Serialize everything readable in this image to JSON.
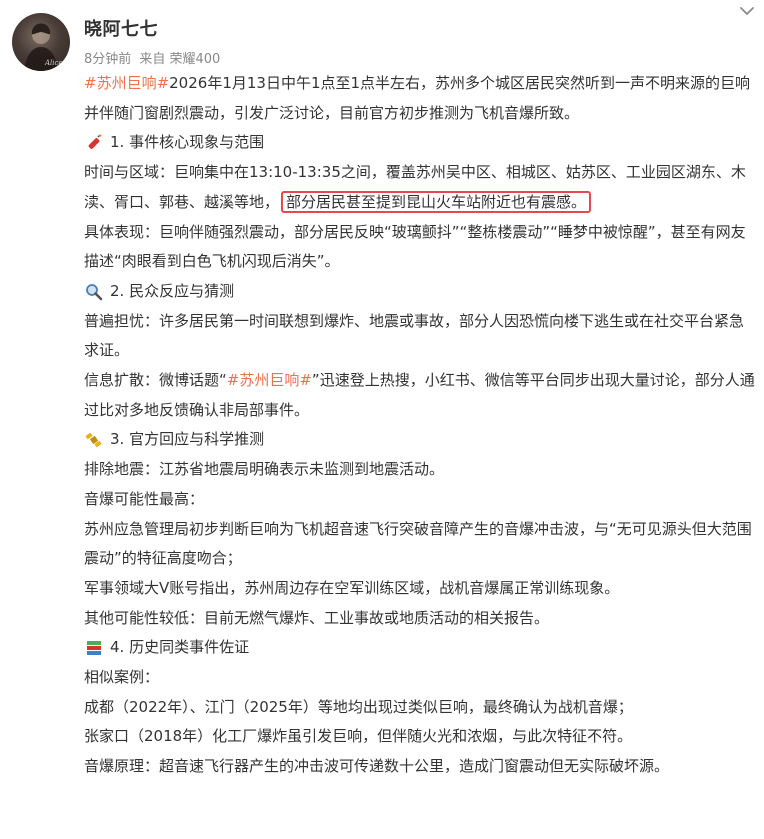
{
  "post": {
    "username": "晓阿七七",
    "time": "8分钟前",
    "source_prefix": "来自",
    "device": "荣耀400",
    "hashtag": "#苏州巨响#",
    "intro": "2026年1月13日中午1点至1点半左右，苏州多个城区居民突然听到一声不明来源的巨响并伴随门窗剧烈震动，引发广泛讨论，目前官方初步推测为飞机音爆所致。",
    "sections": {
      "s1": {
        "title": "1. 事件核心现象与范围",
        "line1a": "时间与区域：巨响集中在13:10-13:35之间，覆盖苏州吴中区、相城区、姑苏区、工业园区湖东、木渎、胥口、郭巷、越溪等地，",
        "line1_highlight": "部分居民甚至提到昆山火车站附近也有震感。",
        "line2": "具体表现：巨响伴随强烈震动，部分居民反映“玻璃颤抖”“整栋楼震动”“睡梦中被惊醒”，甚至有网友描述“肉眼看到白色飞机闪现后消失”。"
      },
      "s2": {
        "title": "2. 民众反应与猜测",
        "line1": "普遍担忧：许多居民第一时间联想到爆炸、地震或事故，部分人因恐慌向楼下逃生或在社交平台紧急求证。",
        "line2a": "信息扩散：微博话题“",
        "line2_tag": "#苏州巨响#",
        "line2b": "”迅速登上热搜，小红书、微信等平台同步出现大量讨论，部分人通过比对多地反馈确认非局部事件。"
      },
      "s3": {
        "title": "3. 官方回应与科学推测",
        "line1": "排除地震：江苏省地震局明确表示未监测到地震活动。",
        "line2": "音爆可能性最高：",
        "line3": "苏州应急管理局初步判断巨响为飞机超音速飞行突破音障产生的音爆冲击波，与“无可见源头但大范围震动”的特征高度吻合；",
        "line4": "军事领域大V账号指出，苏州周边存在空军训练区域，战机音爆属正常训练现象。",
        "line5": "其他可能性较低：目前无燃气爆炸、工业事故或地质活动的相关报告。"
      },
      "s4": {
        "title": "4. 历史同类事件佐证",
        "line1": "相似案例：",
        "line2": "成都（2022年）、江门（2025年）等地均出现过类似巨响，最终确认为战机音爆；",
        "line3": "张家口（2018年）化工厂爆炸虽引发巨响，但伴随火光和浓烟，与此次特征不符。",
        "line4": "音爆原理：超音速飞行器产生的冲击波可传递数十公里，造成门窗震动但无实际破坏源。"
      }
    },
    "icons": {
      "s1": "firecracker-icon",
      "s2": "magnifier-icon",
      "s3": "satellite-icon",
      "s4": "books-icon",
      "menu": "chevron-down-icon"
    },
    "colors": {
      "hashtag": "#eb7350",
      "highlight_border": "#e5484d",
      "meta_text": "#888888"
    }
  }
}
